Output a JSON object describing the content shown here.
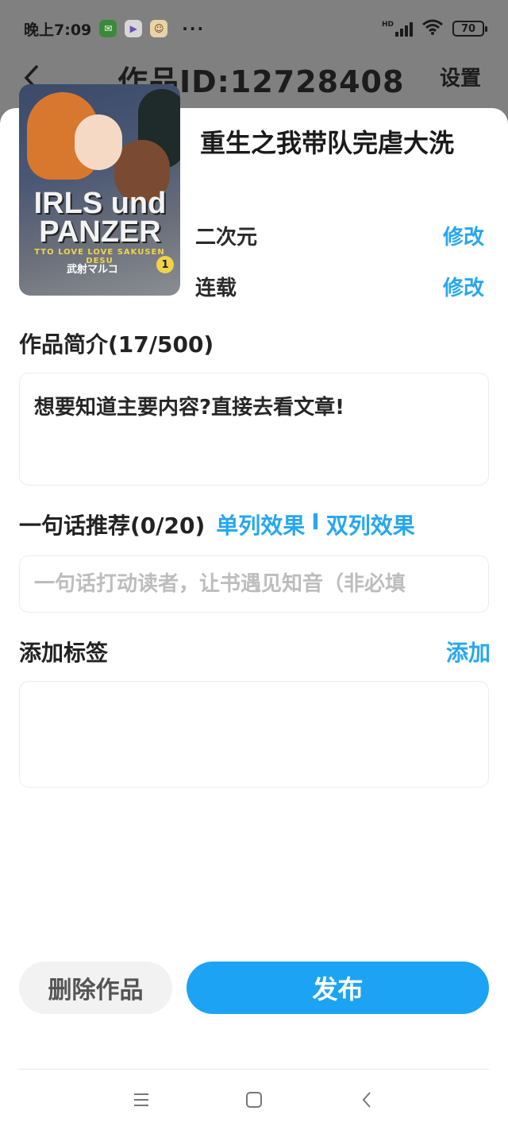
{
  "status_bar": {
    "time": "晚上7:09",
    "dots": "···",
    "network": "HD",
    "battery": "70"
  },
  "header": {
    "back_icon": "chevron-left-icon",
    "title": "作品ID:12728408",
    "settings_label": "设置"
  },
  "work": {
    "title": "重生之我带队完虐大洗",
    "cover": {
      "title_line1": "IRLS und",
      "title_line2": "PANZER",
      "subtitle": "TTO LOVE LOVE SAKUSEN DESU",
      "author": "武射マルコ",
      "volume": "1"
    },
    "category": {
      "label": "二次元",
      "action": "修改"
    },
    "status": {
      "label": "连载",
      "action": "修改"
    }
  },
  "intro": {
    "heading": "作品简介(17/500)",
    "text": "想要知道主要内容?直接去看文章!"
  },
  "oneliner": {
    "heading": "一句话推荐(0/20)",
    "single_mode": "单列效果",
    "separator": "I",
    "double_mode": "双列效果",
    "placeholder": "一句话打动读者，让书遇见知音（非必填"
  },
  "tags": {
    "heading": "添加标签",
    "add_label": "添加"
  },
  "actions": {
    "delete_label": "删除作品",
    "publish_label": "发布"
  },
  "colors": {
    "accent": "#27a7f0",
    "publish": "#1da3f3",
    "backdrop": "#808080"
  }
}
